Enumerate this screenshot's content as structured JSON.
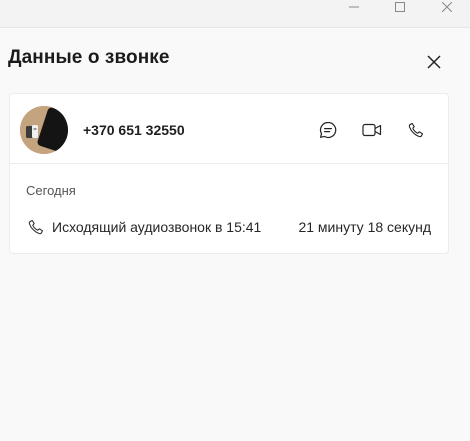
{
  "window": {
    "controls": {
      "minimize_icon": "minimize-icon",
      "maximize_icon": "maximize-icon",
      "close_icon": "close-icon"
    }
  },
  "header": {
    "title": "Данные о звонке",
    "close_icon": "close-icon"
  },
  "contact": {
    "phone": "+370 651 32550",
    "avatar": "contact-avatar",
    "actions": [
      {
        "name": "chat",
        "icon": "chat-bubble-icon"
      },
      {
        "name": "video-call",
        "icon": "video-camera-icon"
      },
      {
        "name": "audio-call",
        "icon": "phone-icon"
      }
    ]
  },
  "history": {
    "section_label": "Сегодня",
    "entries": [
      {
        "icon": "phone-icon",
        "description": "Исходящий аудиозвонок в 15:41",
        "duration": "21 минуту 18 секунд"
      }
    ]
  },
  "colors": {
    "background": "#f9f9f9",
    "card": "#ffffff",
    "text": "#1a1a1a",
    "muted": "#555555"
  }
}
